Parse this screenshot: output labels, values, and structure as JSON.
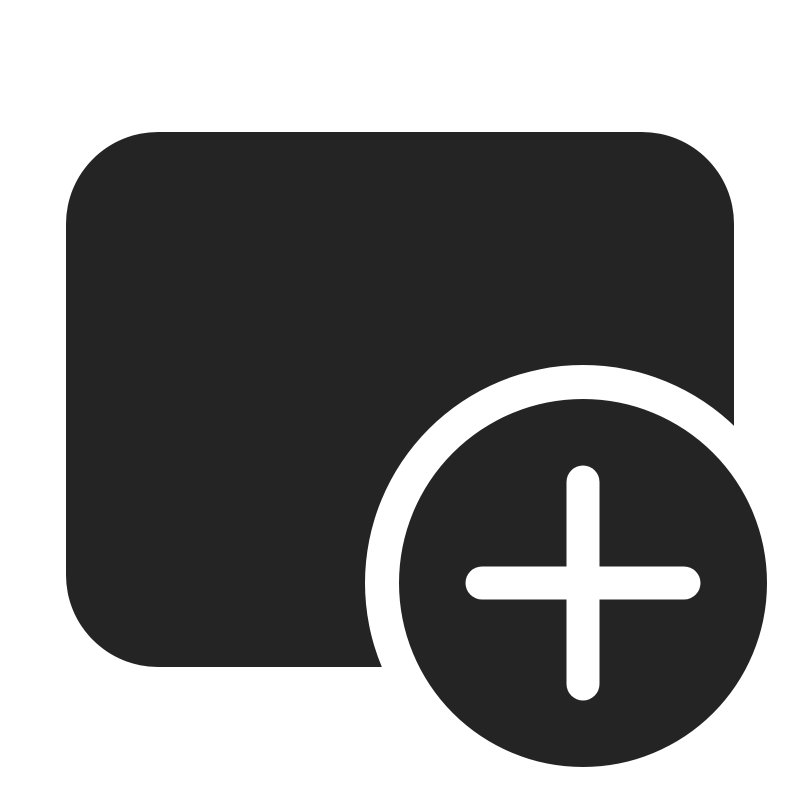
{
  "icon": {
    "name": "tab-add-icon",
    "background_color": "#ffffff",
    "fill_color": "#242424",
    "plus_color": "#ffffff"
  }
}
